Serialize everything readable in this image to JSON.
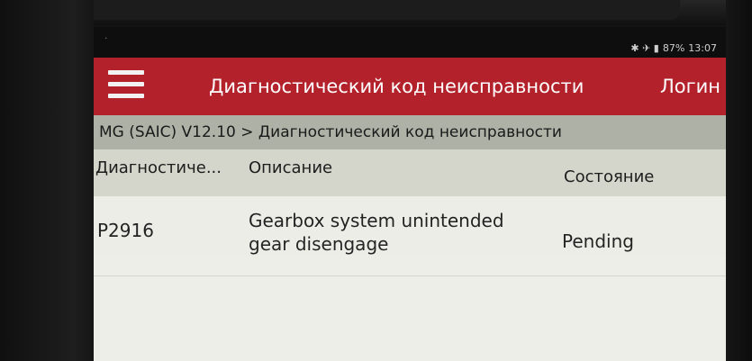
{
  "status_bar": {
    "left_icon": "·",
    "icons": "✱ ✈ ▮",
    "battery": "87%",
    "time": "13:07"
  },
  "app_bar": {
    "title": "Диагностический код неисправности",
    "login_label": "Логин"
  },
  "breadcrumb": "MG (SAIC) V12.10 > Диагностический код неисправности",
  "table": {
    "headers": {
      "code": "Диагностиче...",
      "description": "Описание",
      "state": "Состояние"
    },
    "rows": [
      {
        "code": "P2916",
        "description": "Gearbox system unintended gear disengage",
        "state": "Pending"
      }
    ]
  },
  "colors": {
    "app_bar": "#b3222a",
    "breadcrumb_bg": "#aeb1a6",
    "header_bg": "#d4d6cb",
    "body_bg": "#ecede6"
  }
}
